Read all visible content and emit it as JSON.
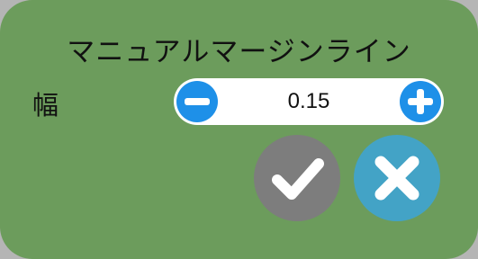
{
  "dialog": {
    "title": "マニュアルマージンライン",
    "width_label": "幅",
    "width_value": "0.15",
    "decrement_icon": "minus-icon",
    "increment_icon": "plus-icon",
    "confirm_icon": "checkmark-icon",
    "cancel_icon": "close-icon"
  },
  "colors": {
    "panel_background": "#6c9c5c",
    "stepper_accent": "#1e90e8",
    "confirm_button": "#7d7d7d",
    "cancel_button": "#43a3c6"
  }
}
